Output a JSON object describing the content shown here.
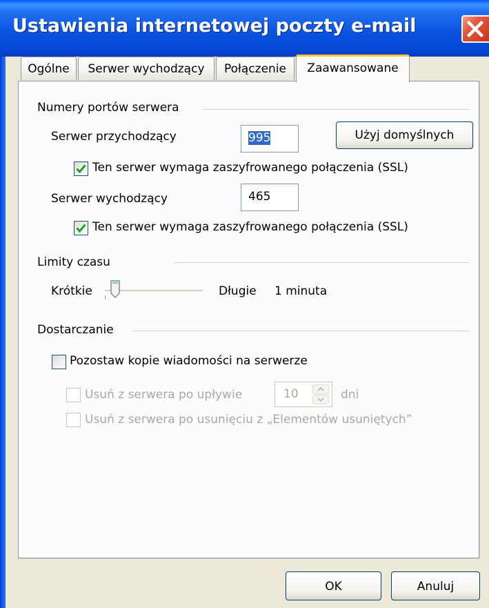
{
  "window": {
    "title": "Ustawienia internetowej poczty e-mail",
    "titlebar_color": "#0a56e0",
    "close_color": "#e2593c"
  },
  "tabs": [
    {
      "label": "Ogólne",
      "active": false
    },
    {
      "label": "Serwer wychodzący",
      "active": false
    },
    {
      "label": "Połączenie",
      "active": false
    },
    {
      "label": "Zaawansowane",
      "active": true
    }
  ],
  "ports": {
    "group_label": "Numery portów serwera",
    "incoming_label": "Serwer przychodzący",
    "incoming_value": "995",
    "default_button": "Użyj domyślnych",
    "incoming_ssl_label": "Ten serwer wymaga zaszyfrowanego połączenia (SSL)",
    "incoming_ssl_checked": true,
    "outgoing_label": "Serwer wychodzący",
    "outgoing_value": "465",
    "outgoing_ssl_label": "Ten serwer wymaga zaszyfrowanego połączenia (SSL)",
    "outgoing_ssl_checked": true
  },
  "timeouts": {
    "group_label": "Limity czasu",
    "short_label": "Krótkie",
    "long_label": "Długie",
    "value_label": "1 minuta",
    "slider_level": 0.1
  },
  "delivery": {
    "group_label": "Dostarczanie",
    "leave_copy_label": "Pozostaw kopie wiadomości na serwerze",
    "leave_copy_checked": false,
    "remove_after_label": "Usuń z serwera po upływie",
    "remove_after_value": "10",
    "days_label": "dni",
    "remove_deleted_label": "Usuń z serwera po usunięciu z „Elementów usuniętych”"
  },
  "footer": {
    "ok_label": "OK",
    "cancel_label": "Anuluj"
  },
  "colors": {
    "check_mark": "#21a121",
    "selection": "#316ac5",
    "active_tab_accent": "#ffc83c"
  }
}
